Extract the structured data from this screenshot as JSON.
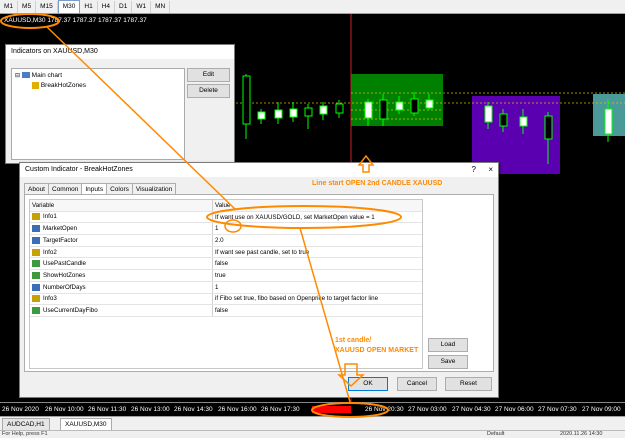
{
  "timeframes": [
    "M1",
    "M5",
    "M15",
    "M30",
    "H1",
    "H4",
    "D1",
    "W1",
    "MN"
  ],
  "active_timeframe": "M30",
  "chart": {
    "title": "XAUUSD,M30  1787.37 1787.37 1787.37 1787.37",
    "time_ticks": [
      "26 Nov 2020",
      "26 Nov 10:00",
      "26 Nov 11:30",
      "26 Nov 13:00",
      "26 Nov 14:30",
      "26 Nov 16:00",
      "26 Nov 17:30",
      "26 Nov 19:00",
      "26 Nov 20:30",
      "27 Nov 03:00",
      "27 Nov 04:30",
      "27 Nov 06:00",
      "27 Nov 07:30",
      "27 Nov 09:00"
    ],
    "highlighted_tick": "26 Nov 19:00",
    "colors": {
      "candle": "#00ff00",
      "zone_green": "#008000",
      "zone_purple": "#5a00b0",
      "zone_teal": "#4a9a9a",
      "dashed_line": "#d6c000",
      "vertical_line": "#d02020"
    }
  },
  "bottom_tabs": [
    "AUDCAD,H1",
    "XAUUSD,M30"
  ],
  "active_bottom_tab": "XAUUSD,M30",
  "status": {
    "left": "For Help, press F1",
    "middle": "Default",
    "right": "2020.11.26 14:30"
  },
  "indicators_window": {
    "title": "Indicators on XAUUSD,M30",
    "tree_root": "Main chart",
    "tree_child": "BreakHotZones",
    "edit_label": "Edit",
    "delete_label": "Delete"
  },
  "custom_indicator": {
    "title": "Custom Indicator - BreakHotZones",
    "help": "?",
    "close": "×",
    "tabs": [
      "About",
      "Common",
      "Inputs",
      "Colors",
      "Visualization"
    ],
    "active_tab": "Inputs",
    "col_variable": "Variable",
    "col_value": "Value",
    "rows": [
      {
        "icon": "ab",
        "name": "Info1",
        "value": "If want use on XAUUSD/GOLD, set MarketOpen value = 1"
      },
      {
        "icon": "123",
        "name": "MarketOpen",
        "value": "1"
      },
      {
        "icon": "v/2",
        "name": "TargetFactor",
        "value": "2.0"
      },
      {
        "icon": "ab",
        "name": "Info2",
        "value": "If want see past candle, set to true"
      },
      {
        "icon": "bool",
        "name": "UsePastCandle",
        "value": "false"
      },
      {
        "icon": "bool",
        "name": "ShowHotZones",
        "value": "true"
      },
      {
        "icon": "123",
        "name": "NumberOfDays",
        "value": "1"
      },
      {
        "icon": "ab",
        "name": "Info3",
        "value": "if Fibo set true, fibo based on Openprice to target factor line"
      },
      {
        "icon": "bool",
        "name": "UseCurrentDayFibo",
        "value": "false"
      }
    ],
    "load_label": "Load",
    "save_label": "Save",
    "ok_label": "OK",
    "cancel_label": "Cancel",
    "reset_label": "Reset"
  },
  "annotations": {
    "line_start": "Line start OPEN 2nd CANDLE  XAUUSD",
    "first_candle_1": "1st candle/",
    "first_candle_2": "XAUUSD OPEN MARKET"
  }
}
